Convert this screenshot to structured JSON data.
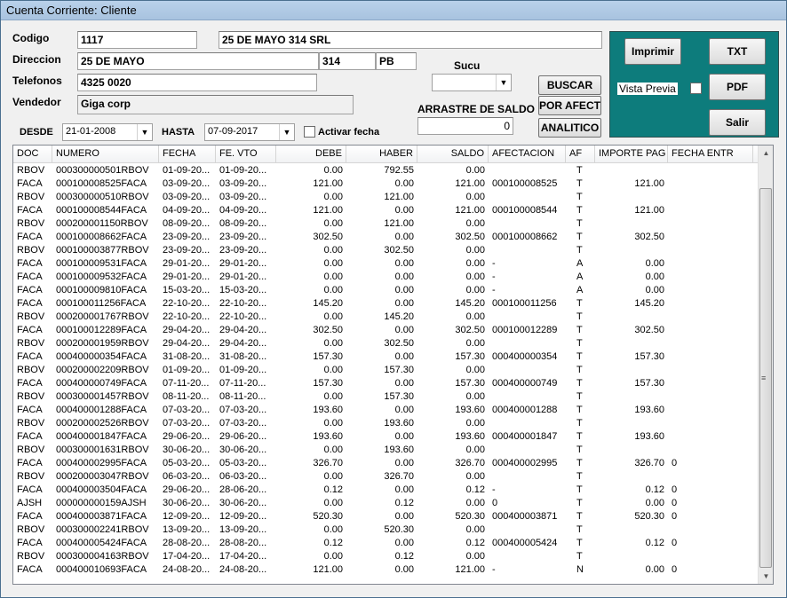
{
  "window": {
    "title": "Cuenta Corriente: Cliente"
  },
  "form": {
    "codigo_label": "Codigo",
    "codigo_value": "1117",
    "nombre_value": "25 DE MAYO 314 SRL",
    "direccion_label": "Direccion",
    "direccion_calle": "25 DE MAYO",
    "direccion_numero": "314",
    "direccion_piso": "PB",
    "telefonos_label": "Telefonos",
    "telefonos_value": "4325 0020",
    "vendedor_label": "Vendedor",
    "vendedor_value": "Giga corp",
    "sucu_label": "Sucu",
    "sucu_value": "",
    "arrastre_label": "ARRASTRE DE SALDO",
    "arrastre_value": "0",
    "desde_label": "DESDE",
    "desde_value": "21-01-2008",
    "hasta_label": "HASTA",
    "hasta_value": "07-09-2017",
    "activar_fecha_label": "Activar fecha"
  },
  "buttons": {
    "buscar": "BUSCAR",
    "por_afect": "POR AFECT",
    "analitico": "ANALITICO",
    "imprimir": "Imprimir",
    "txt": "TXT",
    "vista_previa": "Vista Previa",
    "pdf": "PDF",
    "salir": "Salir"
  },
  "colors": {
    "panel": "#0d7c7c"
  },
  "table": {
    "columns": [
      "DOC",
      "NUMERO",
      "FECHA",
      "FE. VTO",
      "DEBE",
      "HABER",
      "SALDO",
      "AFECTACION",
      "AF",
      "IMPORTE PAG",
      "FECHA ENTR"
    ],
    "rows": [
      [
        "RBOV",
        "000300000501RBOV",
        "01-09-20...",
        "01-09-20...",
        "0.00",
        "792.55",
        "0.00",
        "",
        "T",
        "",
        ""
      ],
      [
        "FACA",
        "000100008525FACA",
        "03-09-20...",
        "03-09-20...",
        "121.00",
        "0.00",
        "121.00",
        "000100008525",
        "T",
        "121.00",
        ""
      ],
      [
        "RBOV",
        "000300000510RBOV",
        "03-09-20...",
        "03-09-20...",
        "0.00",
        "121.00",
        "0.00",
        "",
        "T",
        "",
        ""
      ],
      [
        "FACA",
        "000100008544FACA",
        "04-09-20...",
        "04-09-20...",
        "121.00",
        "0.00",
        "121.00",
        "000100008544",
        "T",
        "121.00",
        ""
      ],
      [
        "RBOV",
        "000200001150RBOV",
        "08-09-20...",
        "08-09-20...",
        "0.00",
        "121.00",
        "0.00",
        "",
        "T",
        "",
        ""
      ],
      [
        "FACA",
        "000100008662FACA",
        "23-09-20...",
        "23-09-20...",
        "302.50",
        "0.00",
        "302.50",
        "000100008662",
        "T",
        "302.50",
        ""
      ],
      [
        "RBOV",
        "000100003877RBOV",
        "23-09-20...",
        "23-09-20...",
        "0.00",
        "302.50",
        "0.00",
        "",
        "T",
        "",
        ""
      ],
      [
        "FACA",
        "000100009531FACA",
        "29-01-20...",
        "29-01-20...",
        "0.00",
        "0.00",
        "0.00",
        "-",
        "A",
        "0.00",
        ""
      ],
      [
        "FACA",
        "000100009532FACA",
        "29-01-20...",
        "29-01-20...",
        "0.00",
        "0.00",
        "0.00",
        "-",
        "A",
        "0.00",
        ""
      ],
      [
        "FACA",
        "000100009810FACA",
        "15-03-20...",
        "15-03-20...",
        "0.00",
        "0.00",
        "0.00",
        "-",
        "A",
        "0.00",
        ""
      ],
      [
        "FACA",
        "000100011256FACA",
        "22-10-20...",
        "22-10-20...",
        "145.20",
        "0.00",
        "145.20",
        "000100011256",
        "T",
        "145.20",
        ""
      ],
      [
        "RBOV",
        "000200001767RBOV",
        "22-10-20...",
        "22-10-20...",
        "0.00",
        "145.20",
        "0.00",
        "",
        "T",
        "",
        ""
      ],
      [
        "FACA",
        "000100012289FACA",
        "29-04-20...",
        "29-04-20...",
        "302.50",
        "0.00",
        "302.50",
        "000100012289",
        "T",
        "302.50",
        ""
      ],
      [
        "RBOV",
        "000200001959RBOV",
        "29-04-20...",
        "29-04-20...",
        "0.00",
        "302.50",
        "0.00",
        "",
        "T",
        "",
        ""
      ],
      [
        "FACA",
        "000400000354FACA",
        "31-08-20...",
        "31-08-20...",
        "157.30",
        "0.00",
        "157.30",
        "000400000354",
        "T",
        "157.30",
        ""
      ],
      [
        "RBOV",
        "000200002209RBOV",
        "01-09-20...",
        "01-09-20...",
        "0.00",
        "157.30",
        "0.00",
        "",
        "T",
        "",
        ""
      ],
      [
        "FACA",
        "000400000749FACA",
        "07-11-20...",
        "07-11-20...",
        "157.30",
        "0.00",
        "157.30",
        "000400000749",
        "T",
        "157.30",
        ""
      ],
      [
        "RBOV",
        "000300001457RBOV",
        "08-11-20...",
        "08-11-20...",
        "0.00",
        "157.30",
        "0.00",
        "",
        "T",
        "",
        ""
      ],
      [
        "FACA",
        "000400001288FACA",
        "07-03-20...",
        "07-03-20...",
        "193.60",
        "0.00",
        "193.60",
        "000400001288",
        "T",
        "193.60",
        ""
      ],
      [
        "RBOV",
        "000200002526RBOV",
        "07-03-20...",
        "07-03-20...",
        "0.00",
        "193.60",
        "0.00",
        "",
        "T",
        "",
        ""
      ],
      [
        "FACA",
        "000400001847FACA",
        "29-06-20...",
        "29-06-20...",
        "193.60",
        "0.00",
        "193.60",
        "000400001847",
        "T",
        "193.60",
        ""
      ],
      [
        "RBOV",
        "000300001631RBOV",
        "30-06-20...",
        "30-06-20...",
        "0.00",
        "193.60",
        "0.00",
        "",
        "T",
        "",
        ""
      ],
      [
        "FACA",
        "000400002995FACA",
        "05-03-20...",
        "05-03-20...",
        "326.70",
        "0.00",
        "326.70",
        "000400002995",
        "T",
        "326.70",
        "0"
      ],
      [
        "RBOV",
        "000200003047RBOV",
        "06-03-20...",
        "06-03-20...",
        "0.00",
        "326.70",
        "0.00",
        "",
        "T",
        "",
        ""
      ],
      [
        "FACA",
        "000400003504FACA",
        "29-06-20...",
        "28-06-20...",
        "0.12",
        "0.00",
        "0.12",
        "-",
        "T",
        "0.12",
        "0"
      ],
      [
        "AJSH",
        "000000000159AJSH",
        "30-06-20...",
        "30-06-20...",
        "0.00",
        "0.12",
        "0.00",
        "0",
        "T",
        "0.00",
        "0"
      ],
      [
        "FACA",
        "000400003871FACA",
        "12-09-20...",
        "12-09-20...",
        "520.30",
        "0.00",
        "520.30",
        "000400003871",
        "T",
        "520.30",
        "0"
      ],
      [
        "RBOV",
        "000300002241RBOV",
        "13-09-20...",
        "13-09-20...",
        "0.00",
        "520.30",
        "0.00",
        "",
        "T",
        "",
        ""
      ],
      [
        "FACA",
        "000400005424FACA",
        "28-08-20...",
        "28-08-20...",
        "0.12",
        "0.00",
        "0.12",
        "000400005424",
        "T",
        "0.12",
        "0"
      ],
      [
        "RBOV",
        "000300004163RBOV",
        "17-04-20...",
        "17-04-20...",
        "0.00",
        "0.12",
        "0.00",
        "",
        "T",
        "",
        ""
      ],
      [
        "FACA",
        "000400010693FACA",
        "24-08-20...",
        "24-08-20...",
        "121.00",
        "0.00",
        "121.00",
        "-",
        "N",
        "0.00",
        "0"
      ]
    ]
  }
}
